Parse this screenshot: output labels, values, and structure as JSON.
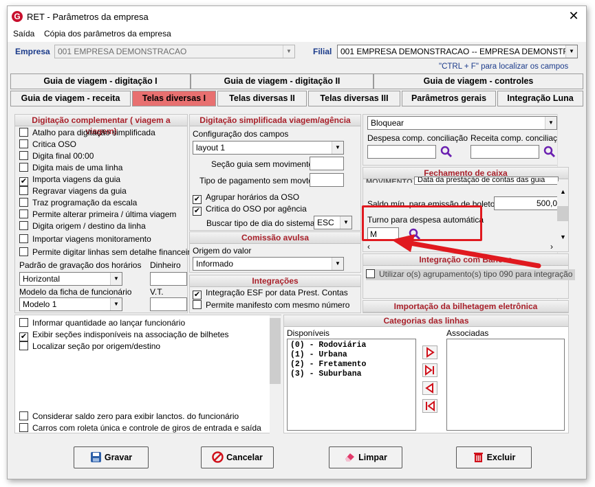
{
  "window": {
    "title": "RET - Parâmetros da empresa",
    "close": "✕"
  },
  "menu": [
    "Saída",
    "Cópia dos parâmetros da empresa"
  ],
  "empresa": {
    "label": "Empresa",
    "value": "001 EMPRESA DEMONSTRACAO"
  },
  "filial": {
    "label": "Filial",
    "value": "001 EMPRESA DEMONSTRACAO -- EMPRESA DEMONSTRAC"
  },
  "hint": {
    "shortcut": "\"CTRL + F\"",
    "text": "para localizar os campos"
  },
  "tabs_row1": [
    "Guia de viagem - digitação I",
    "Guia de viagem - digitação II",
    "Guia de viagem - controles"
  ],
  "tabs_row2": [
    "Guia de viagem - receita",
    "Telas diversas I",
    "Telas diversas II",
    "Telas diversas III",
    "Parâmetros gerais",
    "Integração Luna"
  ],
  "active_tab": "Telas diversas I",
  "dig_comp": {
    "title": "Digitação complementar ( viagem a viagem)",
    "items": [
      {
        "label": "Atalho para digitação simplificada",
        "checked": false
      },
      {
        "label": "Critica OSO",
        "checked": false
      },
      {
        "label": "Digita final 00:00",
        "checked": false
      },
      {
        "label": "Digita mais de uma linha",
        "checked": false
      },
      {
        "label": "Importa viagens da guia",
        "checked": true
      },
      {
        "label": "Regravar viagens da guia",
        "checked": false
      },
      {
        "label": "Traz programação da escala",
        "checked": false
      },
      {
        "label": "Permite alterar primeira / última viagem",
        "checked": false
      },
      {
        "label": "Digita origem / destino da linha",
        "checked": false
      },
      {
        "label": "Importar viagens monitoramento",
        "checked": false
      },
      {
        "label": "Permite digitar linhas sem detalhe financeiro",
        "checked": false
      }
    ],
    "padrao_label": "Padrão de gravação dos horários",
    "padrao_value": "Horizontal",
    "dinheiro_label": "Dinheiro",
    "modelo_label": "Modelo da ficha de funcionário",
    "modelo_value": "Modelo 1",
    "vt_label": "V.T."
  },
  "dig_simpl": {
    "title": "Digitação simplificada viagem/agência",
    "config_label": "Configuração dos campos",
    "config_value": "layout 1",
    "secao_label": "Seção guia sem movimento",
    "tipo_pag_label": "Tipo de pagamento sem movto",
    "agrupar_label": "Agrupar horários da OSO",
    "agrupar_checked": true,
    "critica_label": "Critica do OSO por agência",
    "critica_checked": true,
    "buscar_label": "Buscar tipo de dia do sistema:",
    "buscar_value": "ESC"
  },
  "comissao": {
    "title": "Comissão avulsa",
    "origem_label": "Origem do valor",
    "origem_value": "Informado"
  },
  "integracoes": {
    "title": "Integrações",
    "items": [
      {
        "label": "Integração ESF por data Prest. Contas",
        "checked": true
      },
      {
        "label": "Permite manifesto com mesmo número",
        "checked": false
      }
    ]
  },
  "right_top": {
    "bloquear_value": "Bloquear",
    "despesa_label": "Despesa comp. conciliação",
    "receita_label": "Receita comp. conciliação"
  },
  "fechamento": {
    "title": "Fechamento de caixa",
    "movimento_label": "MOVIMENTO",
    "movimento_value": "Data da prestação de contas das guia",
    "saldo_label": "Saldo mín. para emissão de boletos",
    "saldo_value": "500,0",
    "turno_label": "Turno para despesa automática",
    "turno_value": "M"
  },
  "integ_bancos": {
    "title": "Integração com Bancos",
    "item": "Utilizar o(s) agrupamento(s) tipo 090 para integração"
  },
  "importacao": {
    "title": "Importação da bilhetagem eletrônica"
  },
  "bottom_left": {
    "items": [
      {
        "label": "Informar quantidade ao lançar funcionário",
        "checked": false
      },
      {
        "label": "Exibir seções indisponíveis na associação de bilhetes",
        "checked": true
      },
      {
        "label": "Localizar seção por origem/destino",
        "checked": false
      },
      {
        "label": "Considerar saldo zero para exibir lanctos. do funcionário",
        "checked": false
      },
      {
        "label": "Carros com roleta única e controle de giros de entrada e saída",
        "checked": false
      }
    ]
  },
  "categorias": {
    "title": "Categorias das linhas",
    "disp_label": "Disponíveis",
    "assoc_label": "Associadas",
    "disponiveis": [
      "(0) - Rodoviária",
      "(1) - Urbana",
      "(2) - Fretamento",
      "(3) - Suburbana"
    ]
  },
  "buttons": {
    "gravar": "Gravar",
    "cancelar": "Cancelar",
    "limpar": "Limpar",
    "excluir": "Excluir"
  },
  "colors": {
    "highlight": "#e0191f",
    "active_tab": "#e87070",
    "section_title": "#a8202a",
    "search_icon": "#6a1fb0"
  }
}
